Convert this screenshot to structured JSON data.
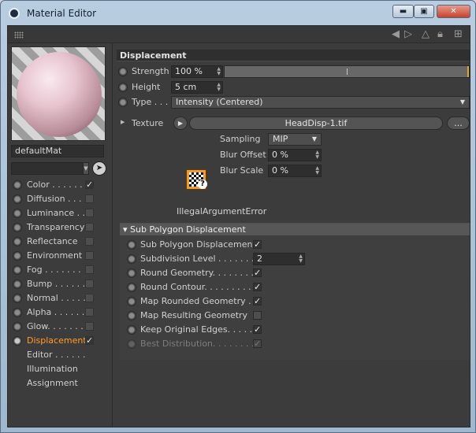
{
  "window": {
    "title": "Material Editor",
    "controls": {
      "minimize": "▬",
      "maximize": "▣",
      "close": "✕"
    }
  },
  "toolbar": {
    "icons": [
      "grip-icon",
      "arrow-left-icon",
      "arrow-right-icon",
      "up-arrow-icon",
      "lock-icon",
      "new-window-icon"
    ]
  },
  "left_panel": {
    "material_name": "defaultMat",
    "channels": [
      {
        "label": "Color . . . . . .",
        "checked": true,
        "selected": false
      },
      {
        "label": "Diffusion . . .",
        "checked": false,
        "selected": false
      },
      {
        "label": "Luminance . .",
        "checked": false,
        "selected": false
      },
      {
        "label": "Transparency",
        "checked": false,
        "selected": false
      },
      {
        "label": "Reflectance",
        "checked": false,
        "selected": false
      },
      {
        "label": "Environment",
        "checked": false,
        "selected": false
      },
      {
        "label": "Fog . . . . . . .",
        "checked": false,
        "selected": false
      },
      {
        "label": "Bump . . . . . .",
        "checked": false,
        "selected": false
      },
      {
        "label": "Normal . . . . .",
        "checked": false,
        "selected": false
      },
      {
        "label": "Alpha . . . . . .",
        "checked": false,
        "selected": false
      },
      {
        "label": "Glow. . . . . . .",
        "checked": false,
        "selected": false
      },
      {
        "label": "Displacement",
        "checked": true,
        "selected": true
      }
    ],
    "extras": [
      "Editor . . . . . .",
      "Illumination",
      "Assignment"
    ]
  },
  "displacement": {
    "header": "Displacement",
    "strength": {
      "label": "Strength",
      "value": "100 %",
      "slider_fraction": 1.0
    },
    "height": {
      "label": "Height",
      "value": "5 cm"
    },
    "type": {
      "label": "Type . . .",
      "value": "Intensity (Centered)"
    },
    "texture": {
      "label": "Texture",
      "file": "HeadDisp-1.tif",
      "more_button": "...",
      "sampling_label": "Sampling",
      "sampling_value": "MIP",
      "blur_offset_label": "Blur Offset",
      "blur_offset_value": "0 %",
      "blur_scale_label": "Blur Scale",
      "blur_scale_value": "0 %",
      "error": "IllegalArgumentError"
    }
  },
  "sub_polygon": {
    "header": "Sub Polygon Displacement",
    "rows": [
      {
        "label": "Sub Polygon Displacement",
        "type": "check",
        "checked": true,
        "disabled": false
      },
      {
        "label": "Subdivision Level . . . . . . . .",
        "type": "number",
        "value": "2",
        "disabled": false
      },
      {
        "label": "Round Geometry. . . . . . . . .",
        "type": "check",
        "checked": true,
        "disabled": false
      },
      {
        "label": "Round Contour. . . . . . . . . .",
        "type": "check",
        "checked": true,
        "disabled": false
      },
      {
        "label": "Map Rounded Geometry . .",
        "type": "check",
        "checked": true,
        "disabled": false
      },
      {
        "label": "Map Resulting Geometry",
        "type": "check",
        "checked": false,
        "disabled": false
      },
      {
        "label": "Keep Original Edges. . . . . .",
        "type": "check",
        "checked": true,
        "disabled": false
      },
      {
        "label": "Best Distribution. . . . . . . . .",
        "type": "check",
        "checked": true,
        "disabled": true
      }
    ]
  },
  "colors": {
    "accent": "#ff9c2a",
    "panel_bg": "#3c3c3c",
    "titlebar": "#b9cde0"
  }
}
